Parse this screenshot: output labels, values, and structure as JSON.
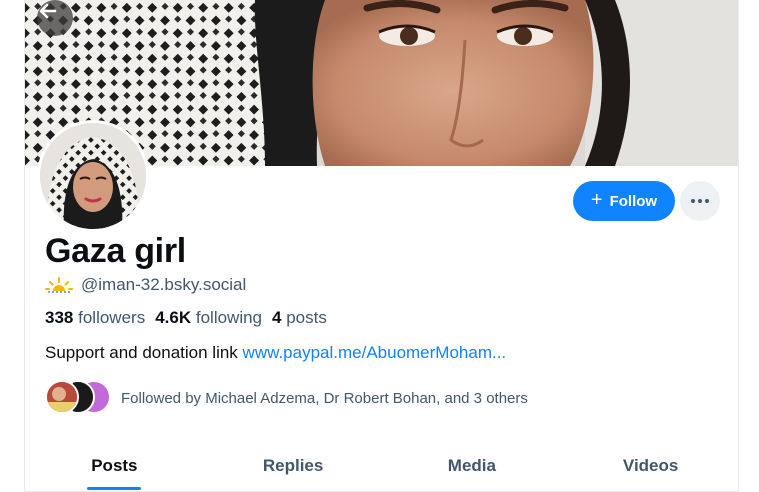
{
  "profile": {
    "display_name": "Gaza girl",
    "handle": "@iman-32.bsky.social",
    "stats": {
      "followers_count": "338",
      "followers_label": "followers",
      "following_count": "4.6K",
      "following_label": "following",
      "posts_count": "4",
      "posts_label": "posts"
    },
    "bio_text": "Support and donation link",
    "bio_link": "www.paypal.me/AbuomerMoham...",
    "followed_by": "Followed by Michael Adzema, Dr Robert Bohan, and 3 others"
  },
  "actions": {
    "follow_label": "Follow",
    "follow_icon": "plus-icon",
    "more_icon": "ellipsis-icon",
    "back_icon": "arrow-left-icon"
  },
  "tabs": [
    {
      "label": "Posts",
      "active": true
    },
    {
      "label": "Replies",
      "active": false
    },
    {
      "label": "Media",
      "active": false
    },
    {
      "label": "Videos",
      "active": false
    }
  ],
  "colors": {
    "accent": "#1083fe",
    "text_primary": "#0b0f14",
    "text_secondary": "#42576c",
    "divider": "#e6e9ee",
    "handle_icon": "#f5b800"
  }
}
